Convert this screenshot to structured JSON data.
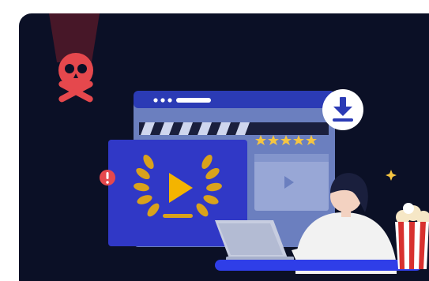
{
  "colors": {
    "background": "#0b1026",
    "skull": "#e5484d",
    "spotlight": "#7a1e2a",
    "window_bar": "#2b3bb5",
    "window_body": "#6b7fbf",
    "clapper": "#1a1f3d",
    "poster": "#3a3fd6",
    "laurel": "#d9a21b",
    "play": "#f4b400",
    "stars": "#f5c542",
    "thumb_panel": "#98a7d6",
    "download_badge_bg": "#ffffff",
    "download_arrow": "#2b3bb5",
    "alert": "#e5484d",
    "person_skin": "#f3d2c1",
    "person_shirt": "#f2f2f2",
    "hair": "#1a1f3d",
    "laptop": "#c7cde0",
    "desk_bar": "#2f3ee8",
    "popcorn_red": "#d8312f",
    "popcorn_white": "#ffffff",
    "popcorn_kernel": "#f6e7c6"
  },
  "icons": {
    "skull": "skull-crossbones-icon",
    "download": "download-icon",
    "alert": "exclamation-icon",
    "play": "play-icon",
    "laurel": "laurel-wreath-icon",
    "star": "star-icon",
    "popcorn": "popcorn-icon",
    "laptop": "laptop-icon"
  },
  "rating": {
    "stars_filled": 5,
    "stars_total": 5
  }
}
